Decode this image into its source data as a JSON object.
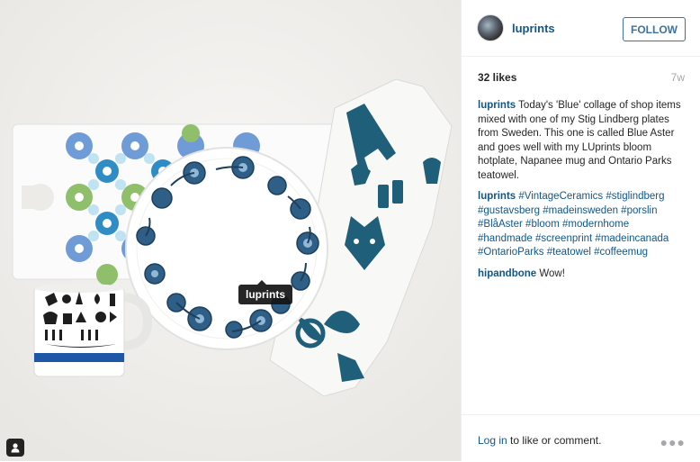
{
  "post": {
    "username": "luprints",
    "follow_label": "FOLLOW",
    "likes": "32 likes",
    "age": "7w",
    "photo_tag": "luprints",
    "photo_description_icon": "user-tag-icon",
    "comments": [
      {
        "user": "luprints",
        "text": "Today's 'Blue' collage of shop items mixed with one of my Stig Lindberg plates from Sweden. This one is called Blue Aster and goes well with my LUprints bloom hotplate, Napanee mug and Ontario Parks teatowel."
      },
      {
        "user": "luprints",
        "text": "#VintageCeramics #stiglindberg #gustavsberg #madeinsweden #porslin #BlåAster #bloom #modernhome #handmade #screenprint #madeincanada #OntarioParks #teatowel #coffeemug"
      },
      {
        "user": "hipandbone",
        "text": "Wow!"
      }
    ],
    "footer": {
      "login_link": "Log in",
      "login_text": " to like or comment.",
      "more_icon": "ellipsis-icon"
    }
  },
  "colors": {
    "link": "#125688",
    "follow": "#3f729b",
    "muted": "#a5a7aa",
    "plate_blue": "#2f5f86",
    "towel_teal": "#1f5f7a"
  }
}
